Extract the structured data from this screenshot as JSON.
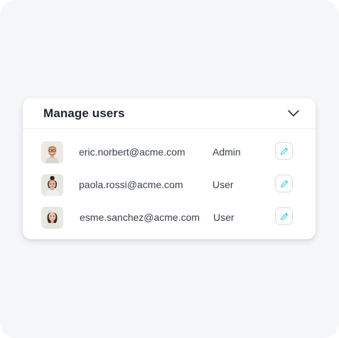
{
  "panel": {
    "title": "Manage users"
  },
  "users": [
    {
      "email": "eric.norbert@acme.com",
      "role": "Admin"
    },
    {
      "email": "paola.rossi@acme.com",
      "role": "User"
    },
    {
      "email": "esme.sanchez@acme.com",
      "role": "User"
    }
  ],
  "icons": {
    "collapse": "chevron-down-icon",
    "edit": "pencil-icon"
  },
  "colors": {
    "page_background": "#f5f6f8",
    "card_background": "#ffffff",
    "title_text": "#1e2433",
    "body_text": "#3a4150",
    "edit_icon_accent": "#3ad0e6",
    "divider": "#eceef2"
  }
}
